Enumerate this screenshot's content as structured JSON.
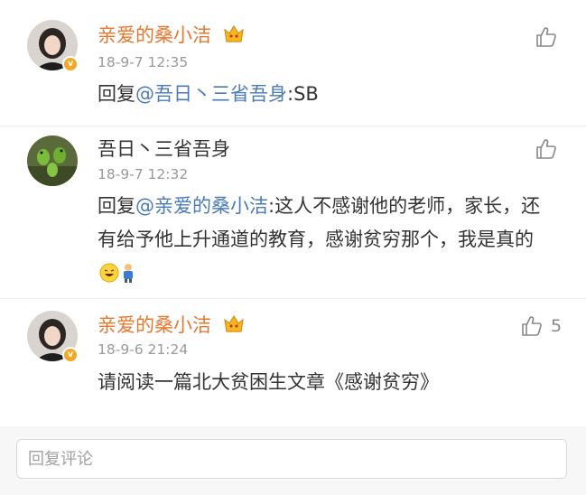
{
  "comments": [
    {
      "author": "亲爱的桑小洁",
      "time": "18-9-7 12:35",
      "reply_prefix": "回复",
      "mention": "@吾日丶三省吾身",
      "text": ":SB",
      "like_icon": "thumbs-up-icon"
    },
    {
      "author": "吾日丶三省吾身",
      "time": "18-9-7 12:32",
      "reply_prefix": "回复",
      "mention": "@亲爱的桑小洁",
      "text": ":这人不感谢他的老师，家长，还有给予他上升通道的教育，感谢贫穷那个，我是真的",
      "like_icon": "thumbs-up-icon"
    },
    {
      "author": "亲爱的桑小洁",
      "time": "18-9-6 21:24",
      "text": "请阅读一篇北大贫困生文章《感谢贫穷》",
      "like_icon": "thumbs-up-icon",
      "like_count": "5"
    }
  ],
  "reply": {
    "placeholder": "回复评论"
  },
  "colors": {
    "author_vip": "#e8772e",
    "mention": "#4a7ab8",
    "time": "#9a9a9a",
    "verified_badge": "#f5a623"
  }
}
